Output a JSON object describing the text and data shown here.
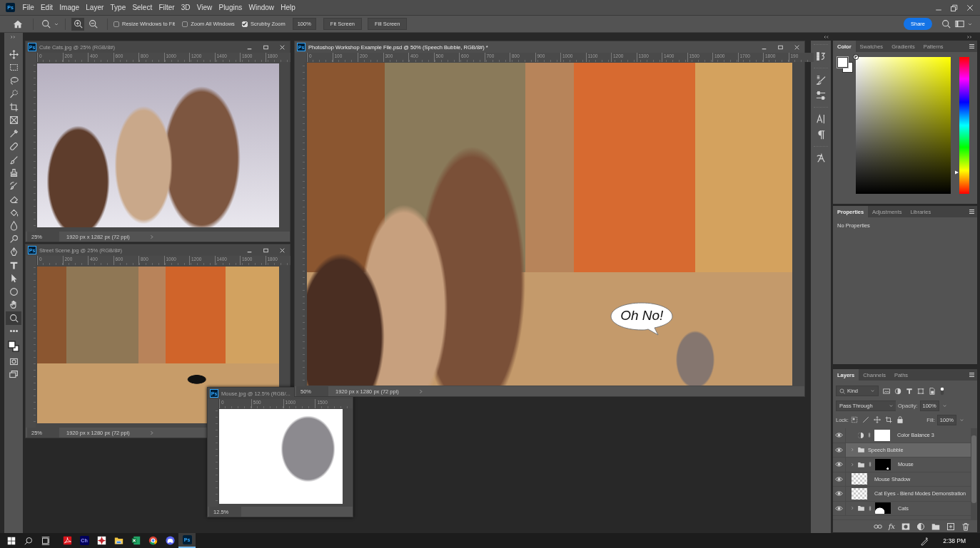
{
  "menu": {
    "logo": "Ps",
    "items": [
      "File",
      "Edit",
      "Image",
      "Layer",
      "Type",
      "Select",
      "Filter",
      "3D",
      "View",
      "Plugins",
      "Window",
      "Help"
    ]
  },
  "options_bar": {
    "zoom_modes": [
      {
        "kind": "zoom-in",
        "selected": true
      },
      {
        "kind": "zoom-out",
        "selected": false
      }
    ],
    "checkboxes": [
      {
        "label": "Resize Windows to Fit",
        "checked": false
      },
      {
        "label": "Zoom All Windows",
        "checked": false
      },
      {
        "label": "Scrubby Zoom",
        "checked": true
      }
    ],
    "zoom_value": "100%",
    "buttons": [
      "Fit Screen",
      "Fill Screen"
    ],
    "share": "Share"
  },
  "tools": [
    {
      "kind": "move",
      "selected": false
    },
    {
      "kind": "marquee",
      "selected": false
    },
    {
      "kind": "lasso",
      "selected": false
    },
    {
      "kind": "quick-select",
      "selected": false
    },
    {
      "kind": "crop",
      "selected": false
    },
    {
      "kind": "frame",
      "selected": false
    },
    {
      "kind": "eyedropper",
      "selected": false
    },
    {
      "kind": "healing",
      "selected": false
    },
    {
      "kind": "brush",
      "selected": false
    },
    {
      "kind": "stamp",
      "selected": false
    },
    {
      "kind": "history",
      "selected": false
    },
    {
      "kind": "eraser",
      "selected": false
    },
    {
      "kind": "bucket",
      "selected": false
    },
    {
      "kind": "blur",
      "selected": false
    },
    {
      "kind": "dodge",
      "selected": false
    },
    {
      "kind": "pen",
      "selected": false
    },
    {
      "kind": "type",
      "selected": false
    },
    {
      "kind": "path-select",
      "selected": false
    },
    {
      "kind": "ellipse",
      "selected": false
    },
    {
      "kind": "hand",
      "selected": false
    },
    {
      "kind": "zoom",
      "selected": true
    },
    {
      "kind": "more",
      "selected": false
    },
    {
      "kind": "colors",
      "selected": false
    },
    {
      "kind": "quick-mask",
      "selected": false
    },
    {
      "kind": "screen-mode",
      "selected": false
    }
  ],
  "documents": [
    {
      "icon": "Ps",
      "title": "Cute Cats.jpg @ 25% (RGB/8#)",
      "active": false,
      "controls": true,
      "ruler": [
        "0",
        "200",
        "400",
        "600",
        "800",
        "1000",
        "1200",
        "1400",
        "1600",
        "1800"
      ],
      "photo": {
        "kind": "cats"
      },
      "zoom": "25%",
      "size": "1920 px x 1282 px (72 ppi)"
    },
    {
      "icon": "Ps",
      "title": "Photoshop Workshop Example File.psd @ 50% (Speech Bubble, RGB/8#) *",
      "active": true,
      "controls": true,
      "ruler": [
        "0",
        "100",
        "200",
        "300",
        "400",
        "500",
        "600",
        "700",
        "800",
        "900",
        "1000",
        "1100",
        "1200",
        "1300",
        "1400",
        "1500",
        "1600",
        "1700",
        "1800",
        "190"
      ],
      "photo": {
        "kind": "composite"
      },
      "overlay_text": "Oh No!",
      "zoom": "50%",
      "size": "1920 px x 1280 px (72 ppi)"
    },
    {
      "icon": "Ps",
      "title": "Street Scene.jpg @ 25% (RGB/8#)",
      "active": false,
      "controls": true,
      "ruler": [
        "0",
        "200",
        "400",
        "600",
        "800",
        "1000",
        "1200",
        "1400",
        "1600",
        "1800"
      ],
      "photo": {
        "kind": "street"
      },
      "zoom": "25%",
      "size": "1920 px x 1280 px (72 ppi)"
    },
    {
      "icon": "Ps",
      "title": "Mouse.jpg @ 12.5% (RGB/...",
      "active": false,
      "ruler": [
        "0",
        "500",
        "1000",
        "1500"
      ],
      "photo": {
        "kind": "mouse"
      },
      "zoom": "12.5%"
    }
  ],
  "color_panel": {
    "hue_slider": {
      "level": 0.17
    },
    "tabs": [
      {
        "label": "Color",
        "selected": true
      },
      {
        "label": "Swatches",
        "selected": false
      },
      {
        "label": "Gradients",
        "selected": false
      },
      {
        "label": "Patterns",
        "selected": false
      }
    ]
  },
  "properties_panel": {
    "tabs": [
      {
        "label": "Properties",
        "selected": true
      },
      {
        "label": "Adjustments",
        "selected": false
      },
      {
        "label": "Libraries",
        "selected": false
      }
    ],
    "message": "No Properties"
  },
  "layers_panel": {
    "tabs": [
      {
        "label": "Layers",
        "selected": true
      },
      {
        "label": "Channels",
        "selected": false
      },
      {
        "label": "Paths",
        "selected": false
      }
    ],
    "filter": "Kind",
    "blend_mode": "Pass Through",
    "opacity_label": "Opacity:",
    "opacity": "100%",
    "lock_label": "Lock:",
    "fill_label": "Fill:",
    "fill": "100%",
    "layers": [
      {
        "name": "Color Balance 3",
        "kind": "adjustment",
        "visible": true,
        "selected": false,
        "linked": true,
        "mask": {
          "kind": "white"
        }
      },
      {
        "name": "Speech Bubble",
        "kind": "group",
        "visible": true,
        "selected": true,
        "linked": false
      },
      {
        "name": "Mouse",
        "kind": "group",
        "visible": true,
        "selected": false,
        "linked": true,
        "mask": {
          "kind": "black"
        }
      },
      {
        "name": "Mouse Shadow",
        "kind": "pixel",
        "visible": true,
        "selected": false,
        "linked": false
      },
      {
        "name": "Cat Eyes - Blend Modes Demonstration",
        "kind": "pixel",
        "visible": true,
        "selected": false,
        "linked": false
      },
      {
        "name": "Cats",
        "kind": "group",
        "visible": true,
        "selected": false,
        "linked": true,
        "mask": {
          "kind": "black-shape"
        }
      }
    ],
    "effects_button": "fx"
  },
  "taskbar": {
    "apps": [
      {
        "kind": "acrobat",
        "selected": false
      },
      {
        "kind": "character-animator",
        "label": "Ch",
        "selected": false
      },
      {
        "kind": "red-app",
        "selected": false
      },
      {
        "kind": "explorer",
        "selected": false
      },
      {
        "kind": "excel",
        "selected": false
      },
      {
        "kind": "chrome",
        "selected": false
      },
      {
        "kind": "discord",
        "selected": false
      },
      {
        "kind": "photoshop",
        "label": "Ps",
        "selected": true
      }
    ],
    "time": "2:38 PM"
  }
}
